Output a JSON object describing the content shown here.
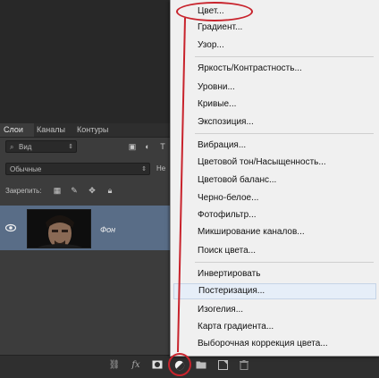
{
  "layers_panel": {
    "tabs": [
      "Слои",
      "Каналы",
      "Контуры"
    ],
    "filter_kind": "Вид",
    "blend_mode": "Обычные",
    "opacity_label_partial": "Не",
    "lock_label": "Закрепить:",
    "layer": {
      "name": "Фон",
      "visible": true
    }
  },
  "adjustment_menu": {
    "items": [
      "Цвет...",
      "Градиент...",
      "Узор...",
      "Яркость/Контрастность...",
      "Уровни...",
      "Кривые...",
      "Экспозиция...",
      "Вибрация...",
      "Цветовой тон/Насыщенность...",
      "Цветовой баланс...",
      "Черно-белое...",
      "Фотофильтр...",
      "Микширование каналов...",
      "Поиск цвета...",
      "Инвертировать",
      "Постеризация...",
      "Изогелия...",
      "Карта градиента...",
      "Выборочная коррекция цвета..."
    ],
    "hovered_item": "Постеризация..."
  },
  "bottom_bar_icons": [
    "link-icon",
    "fx-icon",
    "mask-icon",
    "adjustment-layer-icon",
    "folder-icon",
    "new-layer-icon",
    "trash-icon"
  ],
  "colors": {
    "annotation_red": "#c8232c",
    "selected_layer": "#596d87",
    "menu_bg": "#f0f0f0"
  }
}
